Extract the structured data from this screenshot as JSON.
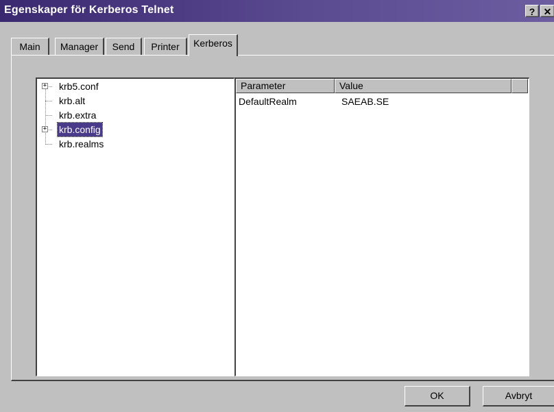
{
  "window": {
    "title": "Egenskaper för Kerberos Telnet",
    "help_label": "?",
    "close_label": "✕"
  },
  "tabs": [
    {
      "label": "Main"
    },
    {
      "label": "Manager"
    },
    {
      "label": "Send"
    },
    {
      "label": "Printer"
    },
    {
      "label": "Kerberos"
    }
  ],
  "active_tab": "Kerberos",
  "tree": {
    "items": [
      {
        "label": "krb5.conf",
        "expandable": true
      },
      {
        "label": "krb.alt",
        "expandable": false
      },
      {
        "label": "krb.extra",
        "expandable": false
      },
      {
        "label": "krb.config",
        "expandable": true,
        "selected": true
      },
      {
        "label": "krb.realms",
        "expandable": false
      }
    ],
    "expander_symbol": "+"
  },
  "list": {
    "columns": [
      "Parameter",
      "Value"
    ],
    "rows": [
      {
        "parameter": "DefaultRealm",
        "value": "SAEAB.SE"
      }
    ]
  },
  "buttons": {
    "ok": "OK",
    "cancel": "Avbryt"
  },
  "colors": {
    "titlebar": "#3a2870",
    "selection": "#4a3a8a",
    "face": "#c0c0c0"
  }
}
